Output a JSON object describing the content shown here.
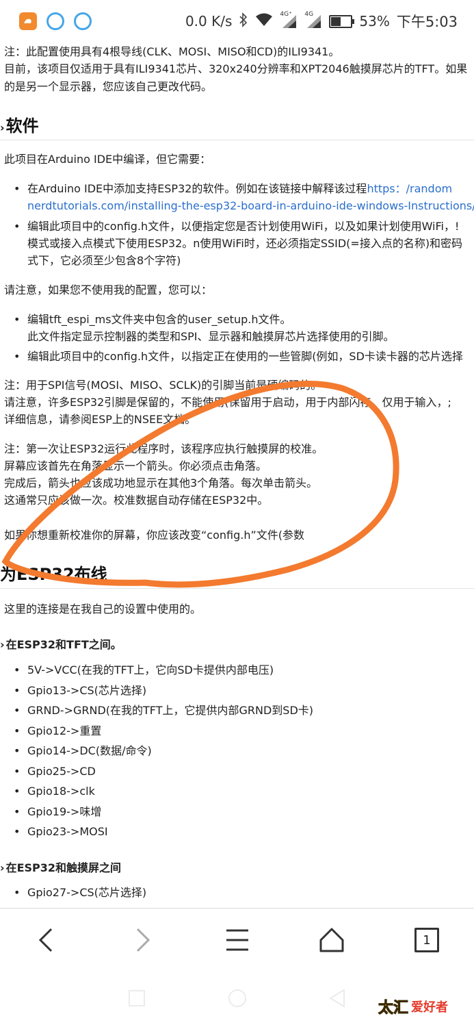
{
  "status_bar": {
    "net_speed": "0.0 K/s",
    "signal1_tag": "4G⁺",
    "signal2_tag": "4G",
    "battery_level": 0.53,
    "battery_text": "53%",
    "time": "下午5:03"
  },
  "article": {
    "note_wiring": "注：此配置使用具有4根导线(CLK、MOSI、MISO和CD)的ILI9341。",
    "current_1": "目前，该项目仅适用于具有ILI9341芯片、320x240分辨率和XPT2046触摸屏芯片的TFT。如果",
    "current_2": "的是另一个显示器，您应该自己更改代码。",
    "software_heading": "软件",
    "software_intro": "此项目在Arduino IDE中编译，但它需要：",
    "sw_item1_a": "在Arduino IDE中添加支持ESP32的软件。例如在该链接中解释该过程",
    "sw_item1_link_a": "https：/random",
    "sw_item1_link_b": "nerdtutorials.com/installing-the-esp32-board-in-arduino-ide-windows-Instructions/",
    "sw_item2_a": "编辑此项目中的config.h文件，以便指定您是否计划使用WiFi，以及如果计划使用WiFi，!",
    "sw_item2_b": "模式或接入点模式下使用ESP32。n使用WiFi时，还必须指定SSID(=接入点的名称)和密码",
    "sw_item2_c": "式下，它必须至少包含8个字符)",
    "config_note": "请注意，如果您不使用我的配置，您可以：",
    "cfg_item1_a": "编辑tft_espi_ms文件夹中包含的user_setup.h文件。",
    "cfg_item1_b": "此文件指定显示控制器的类型和SPI、显示器和触摸屏芯片选择使用的引脚。",
    "cfg_item2": "编辑此项目中的config.h文件，以指定正在使用的一些管脚(例如，SD卡读卡器的芯片选择",
    "spi_note": "注：用于SPI信号(MOSI、MISO、SCLK)的引脚当前是硬编码的。",
    "pins_note_1": "请注意，许多ESP32引脚是保留的，不能使用(保留用于启动，用于内部闪存，仅用于输入，;",
    "pins_note_2": "详细信息，请参阅ESP上的NSEE文档。",
    "calib_1": "注：第一次让ESP32运行此程序时，该程序应执行触摸屏的校准。",
    "calib_2": "屏幕应该首先在角落显示一个箭头。你必须点击角落。",
    "calib_3": "完成后，箭头也应该成功地显示在其他3个角落。每次单击箭头。",
    "calib_4": "这通常只应该做一次。校准数据自动存储在ESP32中。",
    "recalib": "如果你想重新校准你的屏幕，你应该改变“config.h”文件(参数",
    "wiring_heading": "为ESP32布线",
    "wiring_intro": "这里的连接是在我自己的设置中使用的。",
    "tft_heading": "在ESP32和TFT之间。",
    "tft_items": [
      "5V->VCC(在我的TFT上，它向SD卡提供内部电压)",
      "Gpio13->CS(芯片选择)",
      "GRND->GRND(在我的TFT上，它提供内部GRND到SD卡)",
      "Gpio12->重置",
      "Gpio14->DC(数据/命令)",
      "Gpio25->CD",
      "Gpio18->clk",
      "Gpio19->味增",
      "Gpio23->MOSI"
    ],
    "touch_heading": "在ESP32和触摸屏之间",
    "touch_items": [
      "Gpio27->CS(芯片选择)"
    ]
  },
  "nav": {
    "tab_count": "1"
  },
  "watermark": {
    "part_a": "太汇",
    "part_b": "爱好者"
  },
  "colors": {
    "scribble": "#f37a2e",
    "link": "#2a6fcc"
  }
}
